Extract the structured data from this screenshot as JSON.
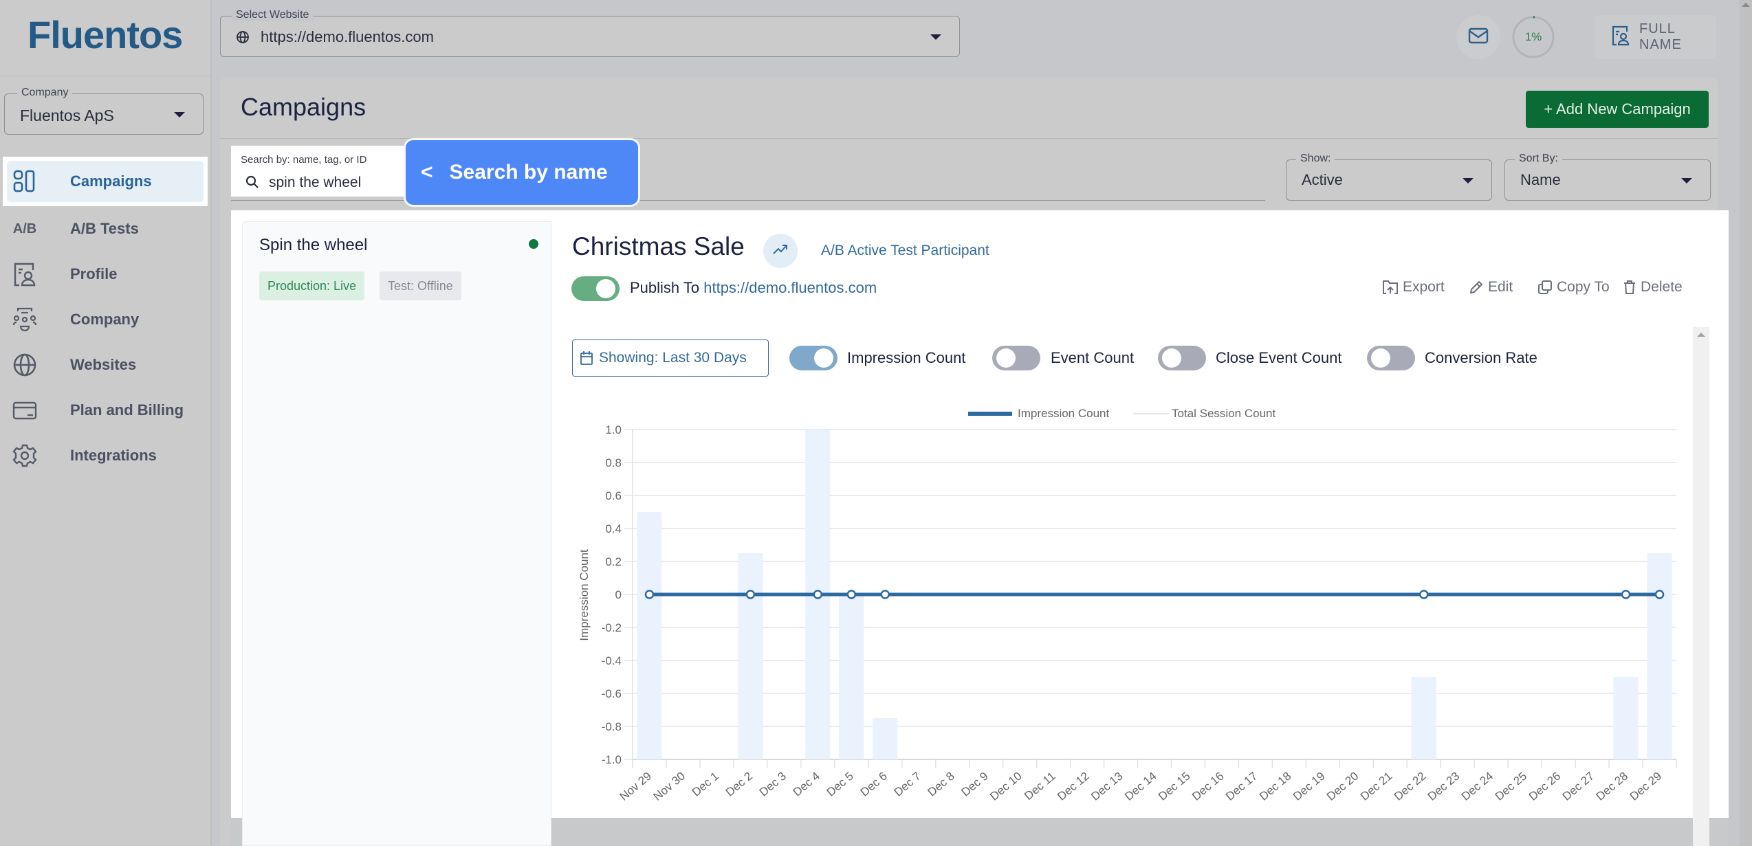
{
  "brand": {
    "logo_text": "Fluentos",
    "accent": "#235a86",
    "primary_green": "#0b6b34",
    "tooltip_blue": "#4e88f6"
  },
  "sidebar": {
    "company_label": "Company",
    "company_value": "Fluentos ApS",
    "items": [
      {
        "label": "Campaigns",
        "icon": "campaigns-grid-icon",
        "active": true
      },
      {
        "label": "A/B Tests",
        "icon": "ab-text-icon",
        "icon_text": "A/B"
      },
      {
        "label": "Profile",
        "icon": "profile-card-icon"
      },
      {
        "label": "Company",
        "icon": "company-people-icon"
      },
      {
        "label": "Websites",
        "icon": "globe-icon"
      },
      {
        "label": "Plan and Billing",
        "icon": "credit-card-icon"
      },
      {
        "label": "Integrations",
        "icon": "gear-icon"
      }
    ]
  },
  "topbar": {
    "website_label": "Select Website",
    "website_value": "https://demo.fluentos.com",
    "progress_text": "1%",
    "progress_value": 0.01,
    "user_name": "FULL NAME"
  },
  "main": {
    "title": "Campaigns",
    "add_button": "+ Add New Campaign",
    "search": {
      "label": "Search by: name, tag, or ID",
      "value": "spin the wheel"
    },
    "tooltip": {
      "arrow": "<",
      "text": "Search by name"
    },
    "show": {
      "label": "Show:",
      "value": "Active"
    },
    "sort": {
      "label": "Sort By:",
      "value": "Name"
    }
  },
  "campaign_list": [
    {
      "name": "Spin the wheel",
      "status_dot": "live",
      "badges": [
        "Production: Live",
        "Test: Offline"
      ]
    }
  ],
  "detail": {
    "title": "Christmas Sale",
    "ab_badge": "A/B Active Test Participant",
    "publish_on": true,
    "publish_prefix": "Publish To",
    "publish_url": "https://demo.fluentos.com",
    "actions": [
      "Export",
      "Edit",
      "Copy To",
      "Delete"
    ],
    "range_button": "Showing: Last 30 Days",
    "metrics": [
      {
        "label": "Impression Count",
        "on": true
      },
      {
        "label": "Event Count",
        "on": false
      },
      {
        "label": "Close Event Count",
        "on": false
      },
      {
        "label": "Conversion Rate",
        "on": false
      }
    ]
  },
  "chart_data": {
    "type": "line",
    "title": "",
    "xlabel": "",
    "ylabel": "Impression Count",
    "ylim": [
      -1.0,
      1.0
    ],
    "yticks": [
      "1.0",
      "0.8",
      "0.6",
      "0.4",
      "0.2",
      "0",
      "-0.2",
      "-0.4",
      "-0.6",
      "-0.8",
      "-1.0"
    ],
    "grid": true,
    "legend_position": "top-center",
    "categories": [
      "Nov 29",
      "Nov 30",
      "Dec 1",
      "Dec 2",
      "Dec 3",
      "Dec 4",
      "Dec 5",
      "Dec 6",
      "Dec 7",
      "Dec 8",
      "Dec 9",
      "Dec 10",
      "Dec 11",
      "Dec 12",
      "Dec 13",
      "Dec 14",
      "Dec 15",
      "Dec 16",
      "Dec 17",
      "Dec 18",
      "Dec 19",
      "Dec 20",
      "Dec 21",
      "Dec 22",
      "Dec 23",
      "Dec 24",
      "Dec 25",
      "Dec 26",
      "Dec 27",
      "Dec 28",
      "Dec 29"
    ],
    "series": [
      {
        "name": "Impression Count",
        "kind": "line",
        "color": "#2d6a9f",
        "values": [
          0,
          0,
          0,
          0,
          0,
          0,
          0,
          0,
          0,
          0,
          0,
          0,
          0,
          0,
          0,
          0,
          0,
          0,
          0,
          0,
          0,
          0,
          0,
          0,
          0,
          0,
          0,
          0,
          0,
          0,
          0
        ],
        "marked_points": [
          "Nov 29",
          "Dec 2",
          "Dec 4",
          "Dec 5",
          "Dec 6",
          "Dec 22",
          "Dec 28",
          "Dec 29"
        ]
      },
      {
        "name": "Total Session Count",
        "kind": "bar-background",
        "color": "#eaf2fd",
        "values": [
          0.5,
          null,
          null,
          0.25,
          null,
          1.0,
          0.0,
          -0.75,
          null,
          null,
          null,
          null,
          null,
          null,
          null,
          null,
          null,
          null,
          null,
          null,
          null,
          null,
          null,
          -0.5,
          null,
          null,
          null,
          null,
          null,
          -0.5,
          0.25
        ]
      }
    ]
  }
}
